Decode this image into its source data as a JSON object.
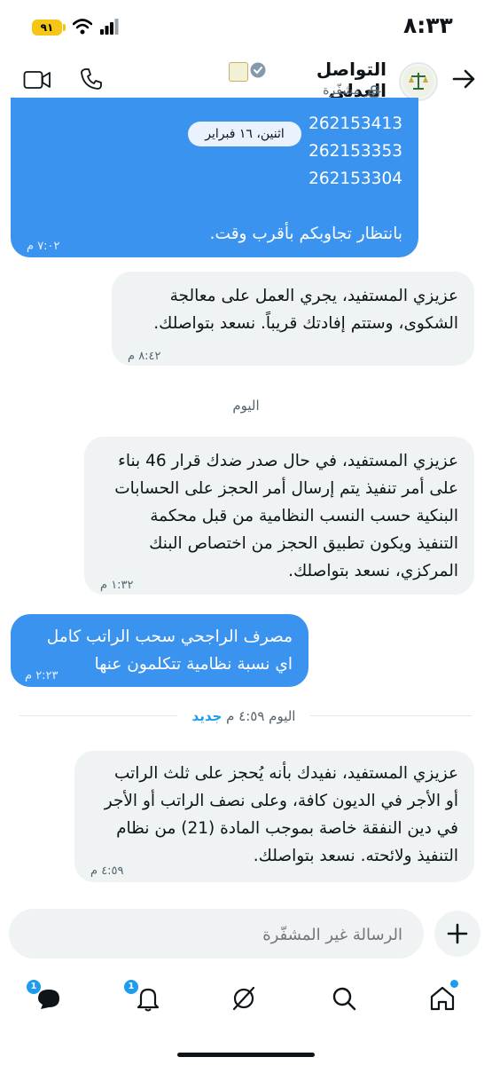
{
  "status_bar": {
    "time": "٨:٣٣",
    "battery": "٩١"
  },
  "header": {
    "contact_name": "التواصل العدلي",
    "encryption_status": "غير مشفّرة"
  },
  "colors": {
    "accent": "#1d9bf0",
    "outgoing_bubble": "#3b93f0",
    "incoming_bubble": "#eff3f4"
  },
  "messages": [
    {
      "direction": "outgoing",
      "text": "262153413\n262153353\n262153304\n\nبانتظار تجاوبكم بأقرب وقت.",
      "time": "٧:٠٢ م"
    },
    {
      "direction": "incoming",
      "text": "عزيزي المستفيد، يجري العمل على معالجة\nالشكوى، وستتم إفادتك قريباً. نسعد بتواصلك.",
      "time": "٨:٤٢ م"
    },
    {
      "direction": "incoming",
      "text": "عزيزي المستفيد، في حال صدر ضدك قرار 46 بناء\nعلى أمر تنفيذ يتم إرسال أمر الحجز على الحسابات\nالبنكية حسب النسب النظامية من قبل محكمة\nالتنفيذ ويكون تطبيق الحجز من اختصاص البنك\nالمركزي، نسعد بتواصلك.",
      "time": "١:٣٢ م"
    },
    {
      "direction": "outgoing",
      "text": "مصرف الراجحي سحب الراتب كامل\nاي نسبة نظامية تتكلمون عنها",
      "time": "٢:٢٣ م"
    },
    {
      "direction": "incoming",
      "text": "عزيزي المستفيد، نفيدك بأنه يُحجز على ثلث الراتب\nأو الأجر في الديون كافة، وعلى نصف الراتب أو الأجر\nفي دين النفقة خاصة بموجب المادة (21) من نظام\nالتنفيذ ولائحته. نسعد بتواصلك.",
      "time": "٤:٥٩ م"
    }
  ],
  "date_chip": "اثنين، ١٦ فبراير",
  "day_separator": "اليوم",
  "new_separator": {
    "label": "اليوم ٤:٥٩ م",
    "new_label": "جديد"
  },
  "composer": {
    "placeholder": "الرسالة غير المشفّرة"
  },
  "bottom_nav": {
    "messages_badge": "1",
    "notifications_badge": "1",
    "icons": [
      "home-icon",
      "search-icon",
      "grok-icon",
      "notifications-icon",
      "messages-icon"
    ]
  }
}
